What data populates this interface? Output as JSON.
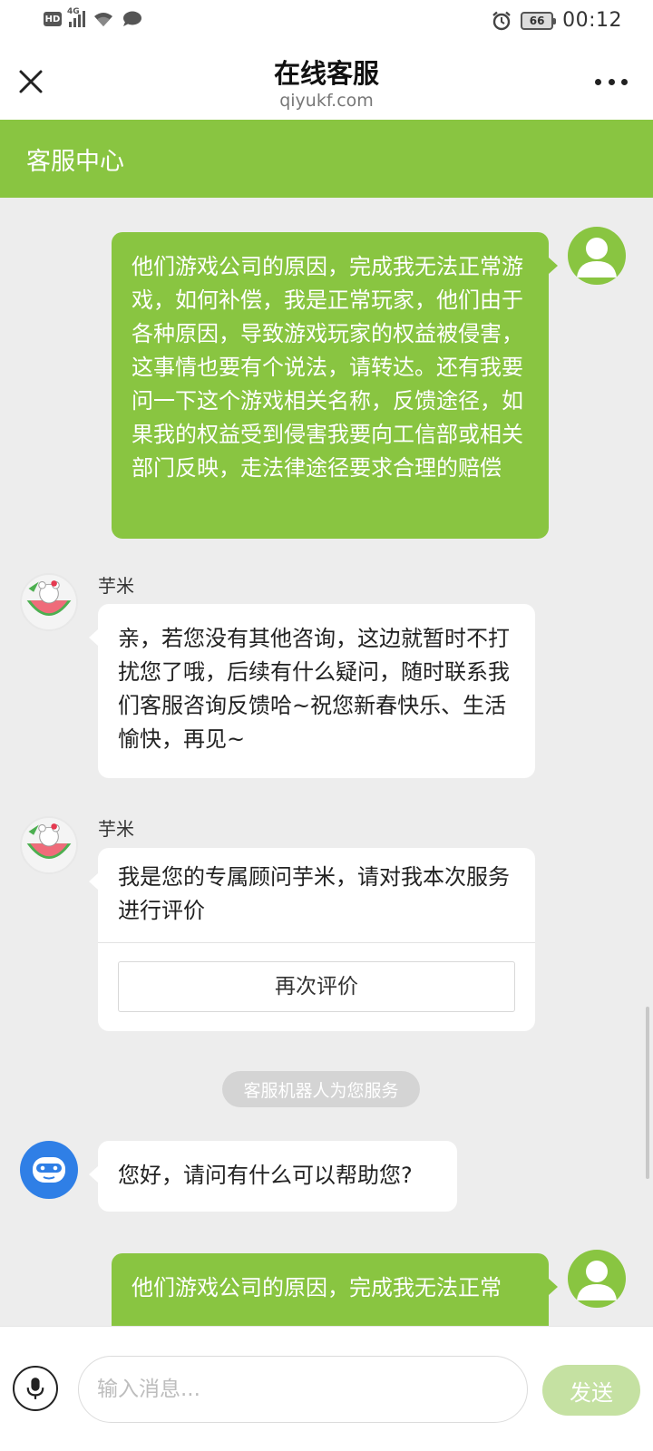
{
  "status_bar": {
    "network": "4G",
    "hd": "HD",
    "battery": "66",
    "time": "00:12"
  },
  "header": {
    "title": "在线客服",
    "subtitle": "qiyukf.com",
    "close_icon": "close-icon",
    "more_icon": "more-dots-icon"
  },
  "service_bar": {
    "title": "客服中心"
  },
  "messages": [
    {
      "from": "user",
      "text": "他们游戏公司的原因，完成我无法正常游戏，如何补偿，我是正常玩家，他们由于各种原因，导致游戏玩家的权益被侵害，这事情也要有个说法，请转达。还有我要问一下这个游戏相关名称，反馈途径，如果我的权益受到侵害我要向工信部或相关部门反映，走法律途径要求合理的赔偿"
    },
    {
      "from": "agent",
      "sender": "芋米",
      "text": "亲，若您没有其他咨询，这边就暂时不打扰您了哦，后续有什么疑问，随时联系我们客服咨询反馈哈~祝您新春快乐、生活愉快，再见~"
    },
    {
      "from": "agent",
      "sender": "芋米",
      "text": "我是您的专属顾问芋米，请对我本次服务进行评价",
      "button": "再次评价"
    },
    {
      "from": "system",
      "text": "客服机器人为您服务"
    },
    {
      "from": "bot",
      "text": "您好，请问有什么可以帮助您?"
    },
    {
      "from": "user",
      "text": "他们游戏公司的原因，完成我无法正常"
    }
  ],
  "input_bar": {
    "placeholder": "输入消息...",
    "send_label": "发送",
    "mic_icon": "microphone-icon"
  },
  "colors": {
    "brand_green": "#89c541",
    "send_disabled": "#c5e1a2",
    "bot_blue": "#2f7fe6",
    "background": "#ededed"
  }
}
